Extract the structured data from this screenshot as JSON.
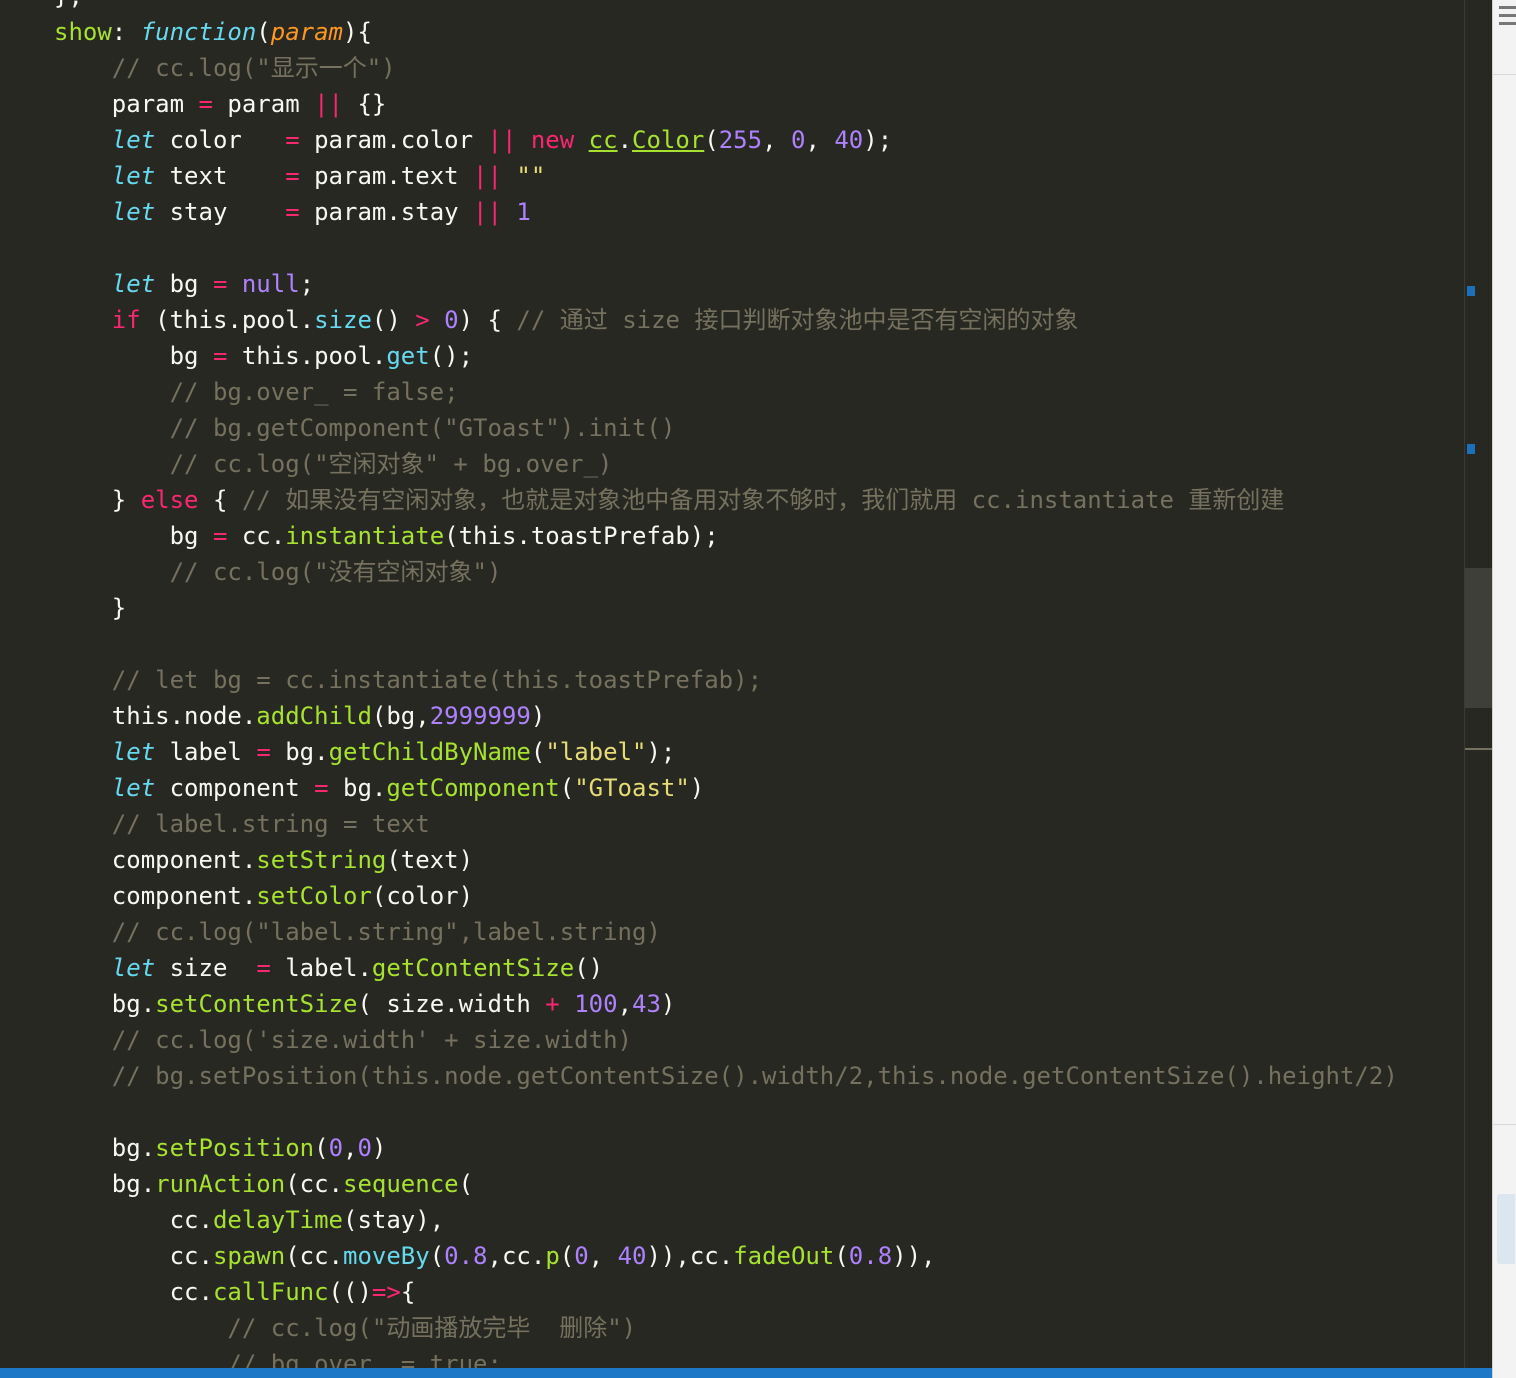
{
  "editor": {
    "lines": [
      [
        [
          "t-plain",
          "};"
        ]
      ],
      [
        [
          "t-key",
          "show"
        ],
        [
          "t-plain",
          ": "
        ],
        [
          "t-fn",
          "function"
        ],
        [
          "t-plain",
          "("
        ],
        [
          "t-param",
          "param"
        ],
        [
          "t-plain",
          "){"
        ]
      ],
      [
        [
          "t-cmt",
          "    // cc.log(\"显示一个\")"
        ]
      ],
      [
        [
          "t-plain",
          "    param "
        ],
        [
          "t-op",
          "="
        ],
        [
          "t-plain",
          " param "
        ],
        [
          "t-op",
          "||"
        ],
        [
          "t-plain",
          " {}"
        ]
      ],
      [
        [
          "t-store",
          "    let"
        ],
        [
          "t-plain",
          " color   "
        ],
        [
          "t-op",
          "="
        ],
        [
          "t-plain",
          " param.color "
        ],
        [
          "t-op",
          "||"
        ],
        [
          "t-plain",
          " "
        ],
        [
          "t-kw",
          "new"
        ],
        [
          "t-plain",
          " "
        ],
        [
          "t-cls",
          "cc"
        ],
        [
          "t-plain",
          "."
        ],
        [
          "t-cls",
          "Color"
        ],
        [
          "t-plain",
          "("
        ],
        [
          "t-num",
          "255"
        ],
        [
          "t-plain",
          ", "
        ],
        [
          "t-num",
          "0"
        ],
        [
          "t-plain",
          ", "
        ],
        [
          "t-num",
          "40"
        ],
        [
          "t-plain",
          ");"
        ]
      ],
      [
        [
          "t-store",
          "    let"
        ],
        [
          "t-plain",
          " text    "
        ],
        [
          "t-op",
          "="
        ],
        [
          "t-plain",
          " param.text "
        ],
        [
          "t-op",
          "||"
        ],
        [
          "t-plain",
          " "
        ],
        [
          "t-str",
          "\"\""
        ]
      ],
      [
        [
          "t-store",
          "    let"
        ],
        [
          "t-plain",
          " stay    "
        ],
        [
          "t-op",
          "="
        ],
        [
          "t-plain",
          " param.stay "
        ],
        [
          "t-op",
          "||"
        ],
        [
          "t-plain",
          " "
        ],
        [
          "t-num",
          "1"
        ]
      ],
      [],
      [
        [
          "t-store",
          "    let"
        ],
        [
          "t-plain",
          " bg "
        ],
        [
          "t-op",
          "="
        ],
        [
          "t-plain",
          " "
        ],
        [
          "t-const",
          "null"
        ],
        [
          "t-plain",
          ";"
        ]
      ],
      [
        [
          "t-kw",
          "    if"
        ],
        [
          "t-plain",
          " (this.pool."
        ],
        [
          "t-supp",
          "size"
        ],
        [
          "t-plain",
          "() "
        ],
        [
          "t-op",
          ">"
        ],
        [
          "t-plain",
          " "
        ],
        [
          "t-num",
          "0"
        ],
        [
          "t-plain",
          ") { "
        ],
        [
          "t-cmt",
          "// 通过 size 接口判断对象池中是否有空闲的对象"
        ]
      ],
      [
        [
          "t-plain",
          "        bg "
        ],
        [
          "t-op",
          "="
        ],
        [
          "t-plain",
          " this.pool."
        ],
        [
          "t-supp",
          "get"
        ],
        [
          "t-plain",
          "();"
        ]
      ],
      [
        [
          "t-cmt",
          "        // bg.over_ = false;"
        ]
      ],
      [
        [
          "t-cmt",
          "        // bg.getComponent(\"GToast\").init()"
        ]
      ],
      [
        [
          "t-cmt",
          "        // cc.log(\"空闲对象\" + bg.over_)"
        ]
      ],
      [
        [
          "t-plain",
          "    } "
        ],
        [
          "t-kw",
          "else"
        ],
        [
          "t-plain",
          " { "
        ],
        [
          "t-cmt",
          "// 如果没有空闲对象，也就是对象池中备用对象不够时，我们就用 cc.instantiate 重新创建"
        ]
      ],
      [
        [
          "t-plain",
          "        bg "
        ],
        [
          "t-op",
          "="
        ],
        [
          "t-plain",
          " cc."
        ],
        [
          "t-call",
          "instantiate"
        ],
        [
          "t-plain",
          "(this.toastPrefab);"
        ]
      ],
      [
        [
          "t-cmt",
          "        // cc.log(\"没有空闲对象\")"
        ]
      ],
      [
        [
          "t-plain",
          "    }"
        ]
      ],
      [],
      [
        [
          "t-cmt",
          "    // let bg = cc.instantiate(this.toastPrefab);"
        ]
      ],
      [
        [
          "t-plain",
          "    this.node."
        ],
        [
          "t-call",
          "addChild"
        ],
        [
          "t-plain",
          "(bg,"
        ],
        [
          "t-num",
          "2999999"
        ],
        [
          "t-plain",
          ")"
        ]
      ],
      [
        [
          "t-store",
          "    let"
        ],
        [
          "t-plain",
          " label "
        ],
        [
          "t-op",
          "="
        ],
        [
          "t-plain",
          " bg."
        ],
        [
          "t-call",
          "getChildByName"
        ],
        [
          "t-plain",
          "("
        ],
        [
          "t-str",
          "\"label\""
        ],
        [
          "t-plain",
          ");"
        ]
      ],
      [
        [
          "t-store",
          "    let"
        ],
        [
          "t-plain",
          " component "
        ],
        [
          "t-op",
          "="
        ],
        [
          "t-plain",
          " bg."
        ],
        [
          "t-call",
          "getComponent"
        ],
        [
          "t-plain",
          "("
        ],
        [
          "t-str",
          "\"GToast\""
        ],
        [
          "t-plain",
          ")"
        ]
      ],
      [
        [
          "t-cmt",
          "    // label.string = text"
        ]
      ],
      [
        [
          "t-plain",
          "    component."
        ],
        [
          "t-call",
          "setString"
        ],
        [
          "t-plain",
          "(text)"
        ]
      ],
      [
        [
          "t-plain",
          "    component."
        ],
        [
          "t-call",
          "setColor"
        ],
        [
          "t-plain",
          "(color)"
        ]
      ],
      [
        [
          "t-cmt",
          "    // cc.log(\"label.string\",label.string)"
        ]
      ],
      [
        [
          "t-store",
          "    let"
        ],
        [
          "t-plain",
          " size  "
        ],
        [
          "t-op",
          "="
        ],
        [
          "t-plain",
          " label."
        ],
        [
          "t-call",
          "getContentSize"
        ],
        [
          "t-plain",
          "()"
        ]
      ],
      [
        [
          "t-plain",
          "    bg."
        ],
        [
          "t-call",
          "setContentSize"
        ],
        [
          "t-plain",
          "( size.width "
        ],
        [
          "t-op",
          "+"
        ],
        [
          "t-plain",
          " "
        ],
        [
          "t-num",
          "100"
        ],
        [
          "t-plain",
          ","
        ],
        [
          "t-num",
          "43"
        ],
        [
          "t-plain",
          ")"
        ]
      ],
      [
        [
          "t-cmt",
          "    // cc.log('size.width' + size.width)"
        ]
      ],
      [
        [
          "t-cmt",
          "    // bg.setPosition(this.node.getContentSize().width/2,this.node.getContentSize().height/2)"
        ]
      ],
      [],
      [
        [
          "t-plain",
          "    bg."
        ],
        [
          "t-call",
          "setPosition"
        ],
        [
          "t-plain",
          "("
        ],
        [
          "t-num",
          "0"
        ],
        [
          "t-plain",
          ","
        ],
        [
          "t-num",
          "0"
        ],
        [
          "t-plain",
          ")"
        ]
      ],
      [
        [
          "t-plain",
          "    bg."
        ],
        [
          "t-call",
          "runAction"
        ],
        [
          "t-plain",
          "(cc."
        ],
        [
          "t-call",
          "sequence"
        ],
        [
          "t-plain",
          "("
        ]
      ],
      [
        [
          "t-plain",
          "        cc."
        ],
        [
          "t-call",
          "delayTime"
        ],
        [
          "t-plain",
          "(stay),"
        ]
      ],
      [
        [
          "t-plain",
          "        cc."
        ],
        [
          "t-call",
          "spawn"
        ],
        [
          "t-plain",
          "(cc."
        ],
        [
          "t-supp",
          "moveBy"
        ],
        [
          "t-plain",
          "("
        ],
        [
          "t-num",
          "0.8"
        ],
        [
          "t-plain",
          ",cc."
        ],
        [
          "t-call",
          "p"
        ],
        [
          "t-plain",
          "("
        ],
        [
          "t-num",
          "0"
        ],
        [
          "t-plain",
          ", "
        ],
        [
          "t-num",
          "40"
        ],
        [
          "t-plain",
          ")),cc."
        ],
        [
          "t-call",
          "fadeOut"
        ],
        [
          "t-plain",
          "("
        ],
        [
          "t-num",
          "0.8"
        ],
        [
          "t-plain",
          ")),"
        ]
      ],
      [
        [
          "t-plain",
          "        cc."
        ],
        [
          "t-call",
          "callFunc"
        ],
        [
          "t-plain",
          "(()"
        ],
        [
          "t-op",
          "=>"
        ],
        [
          "t-plain",
          "{"
        ]
      ],
      [
        [
          "t-cmt",
          "            // cc.log(\"动画播放完毕  删除\")"
        ]
      ],
      [
        [
          "t-cmt",
          "            // bg.over_ = true;"
        ]
      ]
    ]
  },
  "colors": {
    "background": "#272822",
    "scrollbar_marker": "#1c6fb8",
    "status_bar": "#1e78c8"
  },
  "icons": {
    "side_menu": "hamburger-menu-icon"
  }
}
